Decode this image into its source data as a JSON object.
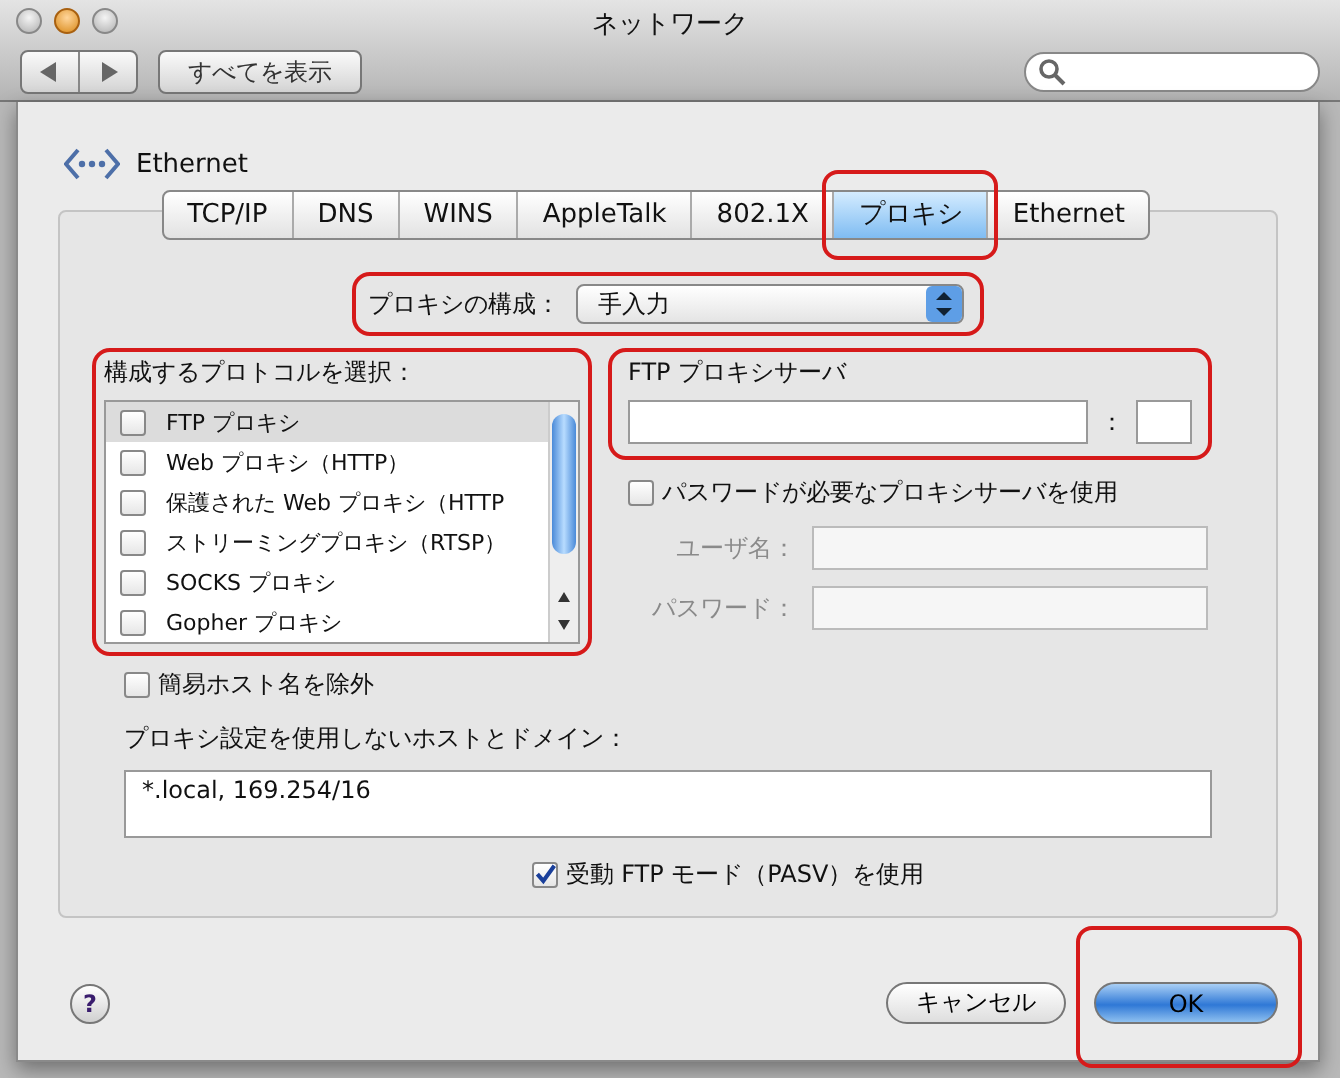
{
  "window": {
    "title": "ネットワーク"
  },
  "toolbar": {
    "show_all_button": "すべてを表示"
  },
  "interface": {
    "name": "Ethernet"
  },
  "tabs": [
    {
      "label": "TCP/IP",
      "selected": false,
      "highlighted": false
    },
    {
      "label": "DNS",
      "selected": false,
      "highlighted": false
    },
    {
      "label": "WINS",
      "selected": false,
      "highlighted": false
    },
    {
      "label": "AppleTalk",
      "selected": false,
      "highlighted": false
    },
    {
      "label": "802.1X",
      "selected": false,
      "highlighted": false
    },
    {
      "label": "プロキシ",
      "selected": true,
      "highlighted": true
    },
    {
      "label": "Ethernet",
      "selected": false,
      "highlighted": false
    }
  ],
  "proxy_config": {
    "label": "プロキシの構成：",
    "value": "手入力",
    "highlighted": true
  },
  "protocols": {
    "label": "構成するプロトコルを選択：",
    "highlighted": true,
    "items": [
      {
        "label": "FTP プロキシ",
        "checked": false,
        "selected": true
      },
      {
        "label": "Web プロキシ（HTTP）",
        "checked": false,
        "selected": false
      },
      {
        "label": "保護された Web プロキシ（HTTP",
        "checked": false,
        "selected": false
      },
      {
        "label": "ストリーミングプロキシ（RTSP）",
        "checked": false,
        "selected": false
      },
      {
        "label": "SOCKS プロキシ",
        "checked": false,
        "selected": false
      },
      {
        "label": "Gopher プロキシ",
        "checked": false,
        "selected": false
      }
    ]
  },
  "proxy_server": {
    "title": "FTP プロキシサーバ",
    "separator": "：",
    "highlighted": true
  },
  "password_required": {
    "label": "パスワードが必要なプロキシサーバを使用",
    "checked": false
  },
  "credentials": [
    {
      "label": "ユーザ名：",
      "disabled": true
    },
    {
      "label": "パスワード：",
      "disabled": true
    }
  ],
  "exclude_simple_hostnames": {
    "label": "簡易ホスト名を除外",
    "checked": false
  },
  "bypass": {
    "label": "プロキシ設定を使用しないホストとドメイン：",
    "value": "*.local, 169.254/16"
  },
  "passive_ftp": {
    "label": "受動 FTP モード（PASV）を使用",
    "checked": true
  },
  "help": "?",
  "buttons": [
    {
      "label": "キャンセル",
      "kind": "secondary",
      "highlighted": false
    },
    {
      "label": "OK",
      "kind": "default",
      "highlighted": true
    }
  ]
}
